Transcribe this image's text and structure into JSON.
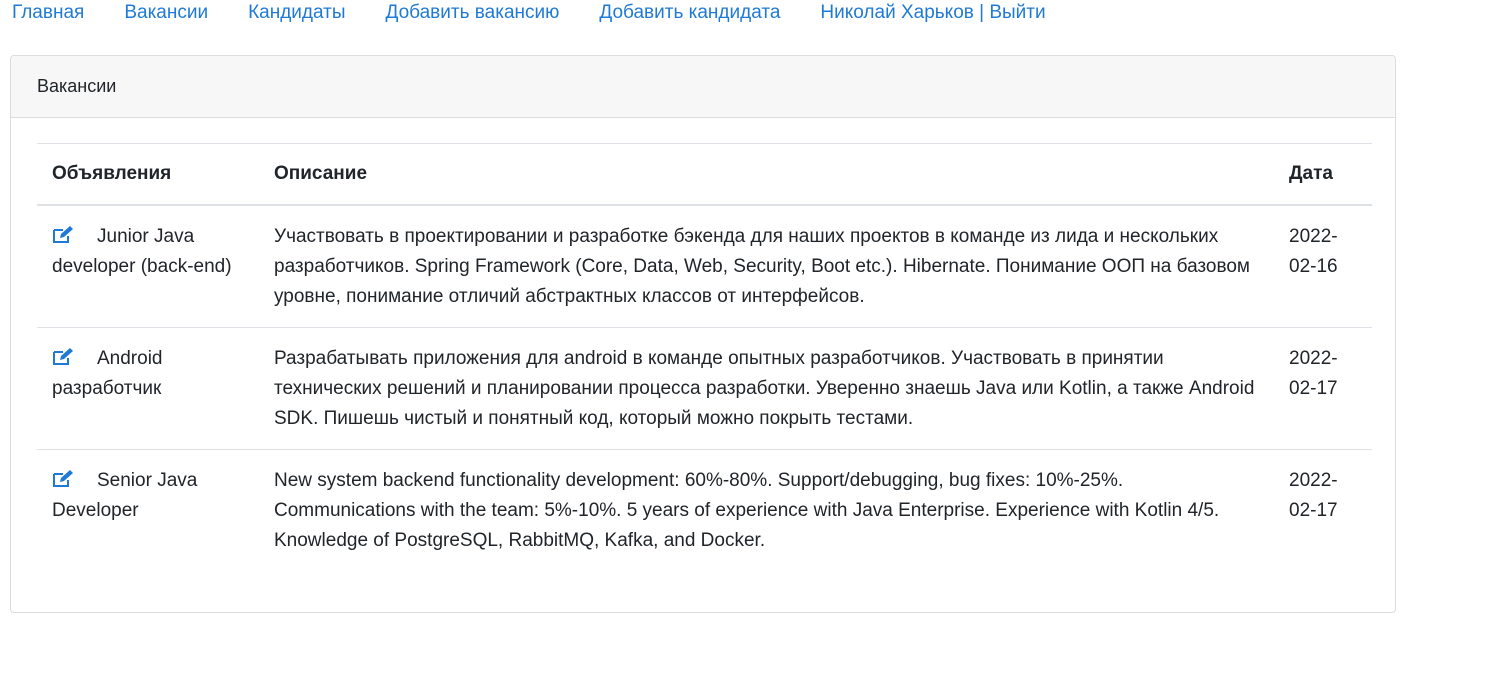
{
  "nav": {
    "items": [
      {
        "label": "Главная"
      },
      {
        "label": "Вакансии"
      },
      {
        "label": "Кандидаты"
      },
      {
        "label": "Добавить вакансию"
      },
      {
        "label": "Добавить кандидата"
      },
      {
        "label": "Николай Харьков | Выйти"
      }
    ]
  },
  "card": {
    "header": "Вакансии",
    "columns": {
      "title": "Объявления",
      "description": "Описание",
      "date": "Дата"
    },
    "rows": [
      {
        "title": "Junior Java developer (back-end)",
        "description": "Участвовать в проектировании и разработке бэкенда для наших проектов в команде из лида и нескольких разработчиков. Spring Framework (Core, Data, Web, Security, Boot etc.). Hibernate. Понимание ООП на базовом уровне, понимание отличий абстрактных классов от интерфейсов.",
        "date": "2022-02-16"
      },
      {
        "title": "Android разработчик",
        "description": "Разрабатывать приложения для android в команде опытных разработчиков. Участвовать в принятии технических решений и планировании процесса разработки. Уверенно знаешь Java или Kotlin, а также Android SDK. Пишешь чистый и понятный код, который можно покрыть тестами.",
        "date": "2022-02-17"
      },
      {
        "title": "Senior Java Developer",
        "description": "New system backend functionality development: 60%-80%. Support/debugging, bug fixes: 10%-25%. Communications with the team: 5%-10%. 5 years of experience with Java Enterprise. Experience with Kotlin 4/5. Knowledge of PostgreSQL, RabbitMQ, Kafka, and Docker.",
        "date": "2022-02-17"
      }
    ]
  },
  "icons": {
    "edit": "edit-icon"
  },
  "colors": {
    "link": "#1f7ad6",
    "text": "#212529",
    "header_bg": "#f7f7f7",
    "border": "#dee2e6"
  }
}
